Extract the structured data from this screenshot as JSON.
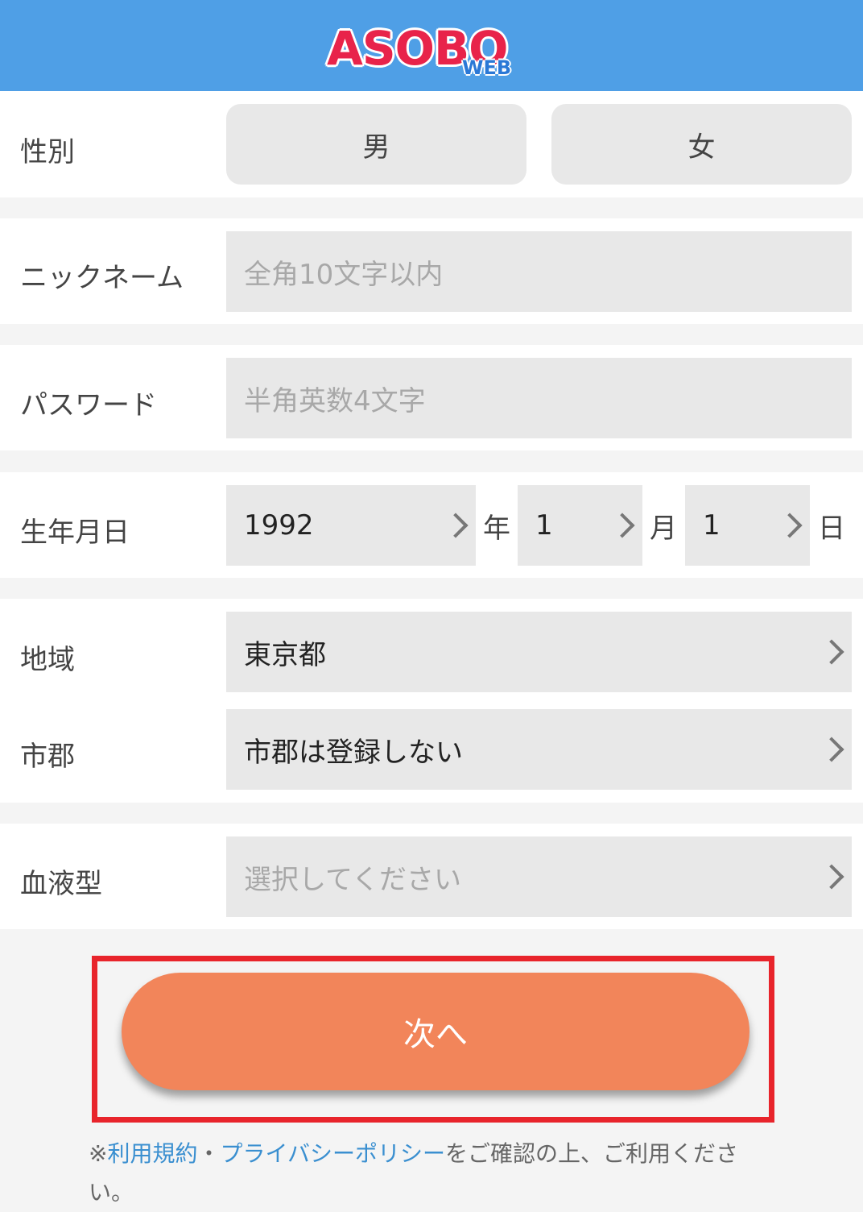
{
  "header": {
    "logo_main": "ASOBO",
    "logo_sub": "WEB",
    "background_color": "#4f9fe6"
  },
  "form": {
    "gender": {
      "label": "性別",
      "options": [
        "男",
        "女"
      ]
    },
    "nickname": {
      "label": "ニックネーム",
      "placeholder": "全角10文字以内"
    },
    "password": {
      "label": "パスワード",
      "placeholder": "半角英数4文字"
    },
    "birthdate": {
      "label": "生年月日",
      "year": "1992",
      "year_unit": "年",
      "month": "1",
      "month_unit": "月",
      "day": "1",
      "day_unit": "日"
    },
    "region": {
      "label": "地域",
      "value": "東京都"
    },
    "city": {
      "label": "市郡",
      "value": "市郡は登録しない"
    },
    "blood_type": {
      "label": "血液型",
      "placeholder": "選択してください"
    }
  },
  "actions": {
    "next_label": "次へ",
    "next_color": "#f2855a",
    "highlight_color": "#e8242b"
  },
  "notice": {
    "prefix": "※",
    "terms_link": "利用規約",
    "separator": "・",
    "privacy_link": "プライバシーポリシー",
    "suffix": "をご確認の上、ご利用ください。"
  }
}
